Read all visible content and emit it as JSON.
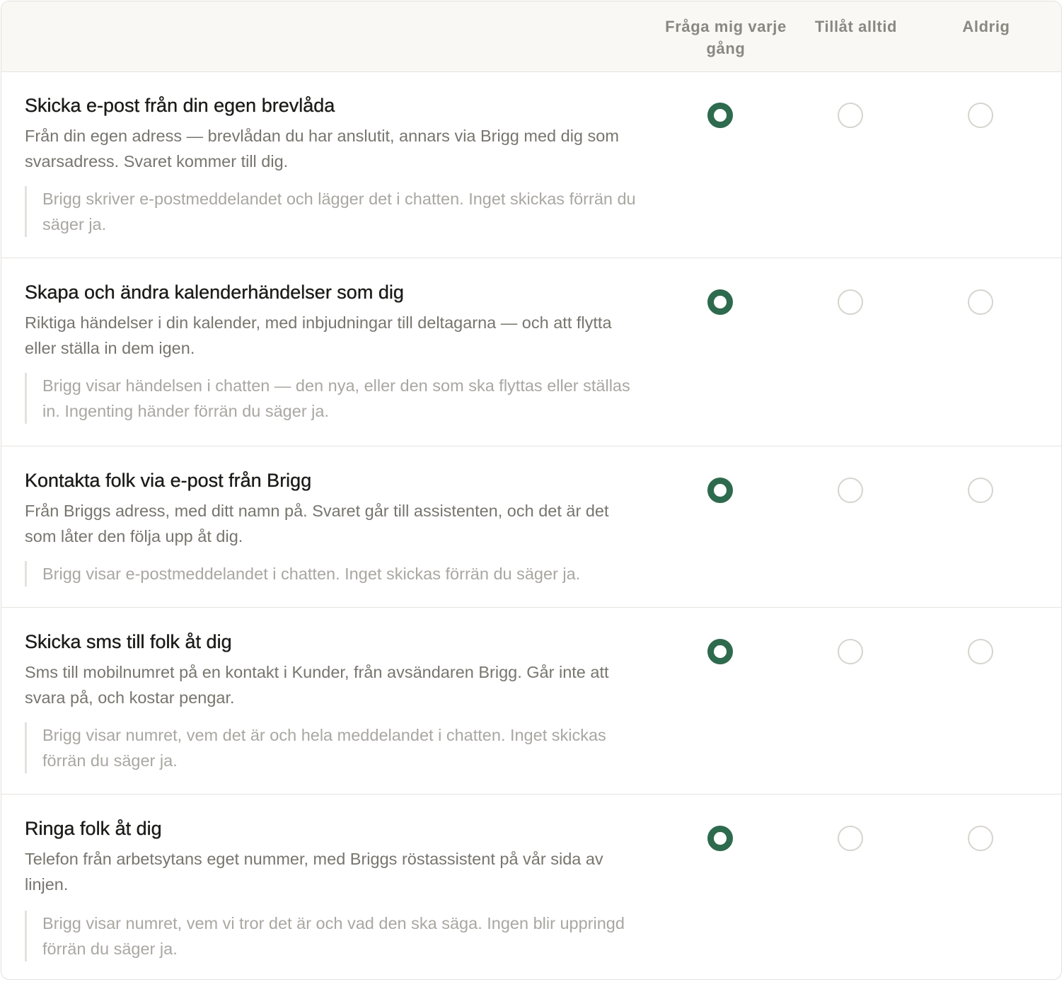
{
  "columns": {
    "ask": "Fråga mig varje gång",
    "always": "Tillåt alltid",
    "never": "Aldrig"
  },
  "colors": {
    "selected": "#2e6a4d",
    "unselected_border": "#d6d4ce"
  },
  "rows": [
    {
      "title": "Skicka e-post från din egen brevlåda",
      "description": "Från din egen adress — brevlådan du har anslutit, annars via Brigg med dig som svarsadress. Svaret kommer till dig.",
      "note": "Brigg skriver e-postmeddelandet och lägger det i chatten. Inget skickas förrän du säger ja.",
      "selected": "ask"
    },
    {
      "title": "Skapa och ändra kalenderhändelser som dig",
      "description": "Riktiga händelser i din kalender, med inbjudningar till deltagarna — och att flytta eller ställa in dem igen.",
      "note": "Brigg visar händelsen i chatten — den nya, eller den som ska flyttas eller ställas in. Ingenting händer förrän du säger ja.",
      "selected": "ask"
    },
    {
      "title": "Kontakta folk via e-post från Brigg",
      "description": "Från Briggs adress, med ditt namn på. Svaret går till assistenten, och det är det som låter den följa upp åt dig.",
      "note": "Brigg visar e-postmeddelandet i chatten. Inget skickas förrän du säger ja.",
      "selected": "ask"
    },
    {
      "title": "Skicka sms till folk åt dig",
      "description": "Sms till mobilnumret på en kontakt i Kunder, från avsändaren Brigg. Går inte att svara på, och kostar pengar.",
      "note": "Brigg visar numret, vem det är och hela meddelandet i chatten. Inget skickas förrän du säger ja.",
      "selected": "ask"
    },
    {
      "title": "Ringa folk åt dig",
      "description": "Telefon från arbetsytans eget nummer, med Briggs röstassistent på vår sida av linjen.",
      "note": "Brigg visar numret, vem vi tror det är och vad den ska säga. Ingen blir uppringd förrän du säger ja.",
      "selected": "ask"
    }
  ]
}
